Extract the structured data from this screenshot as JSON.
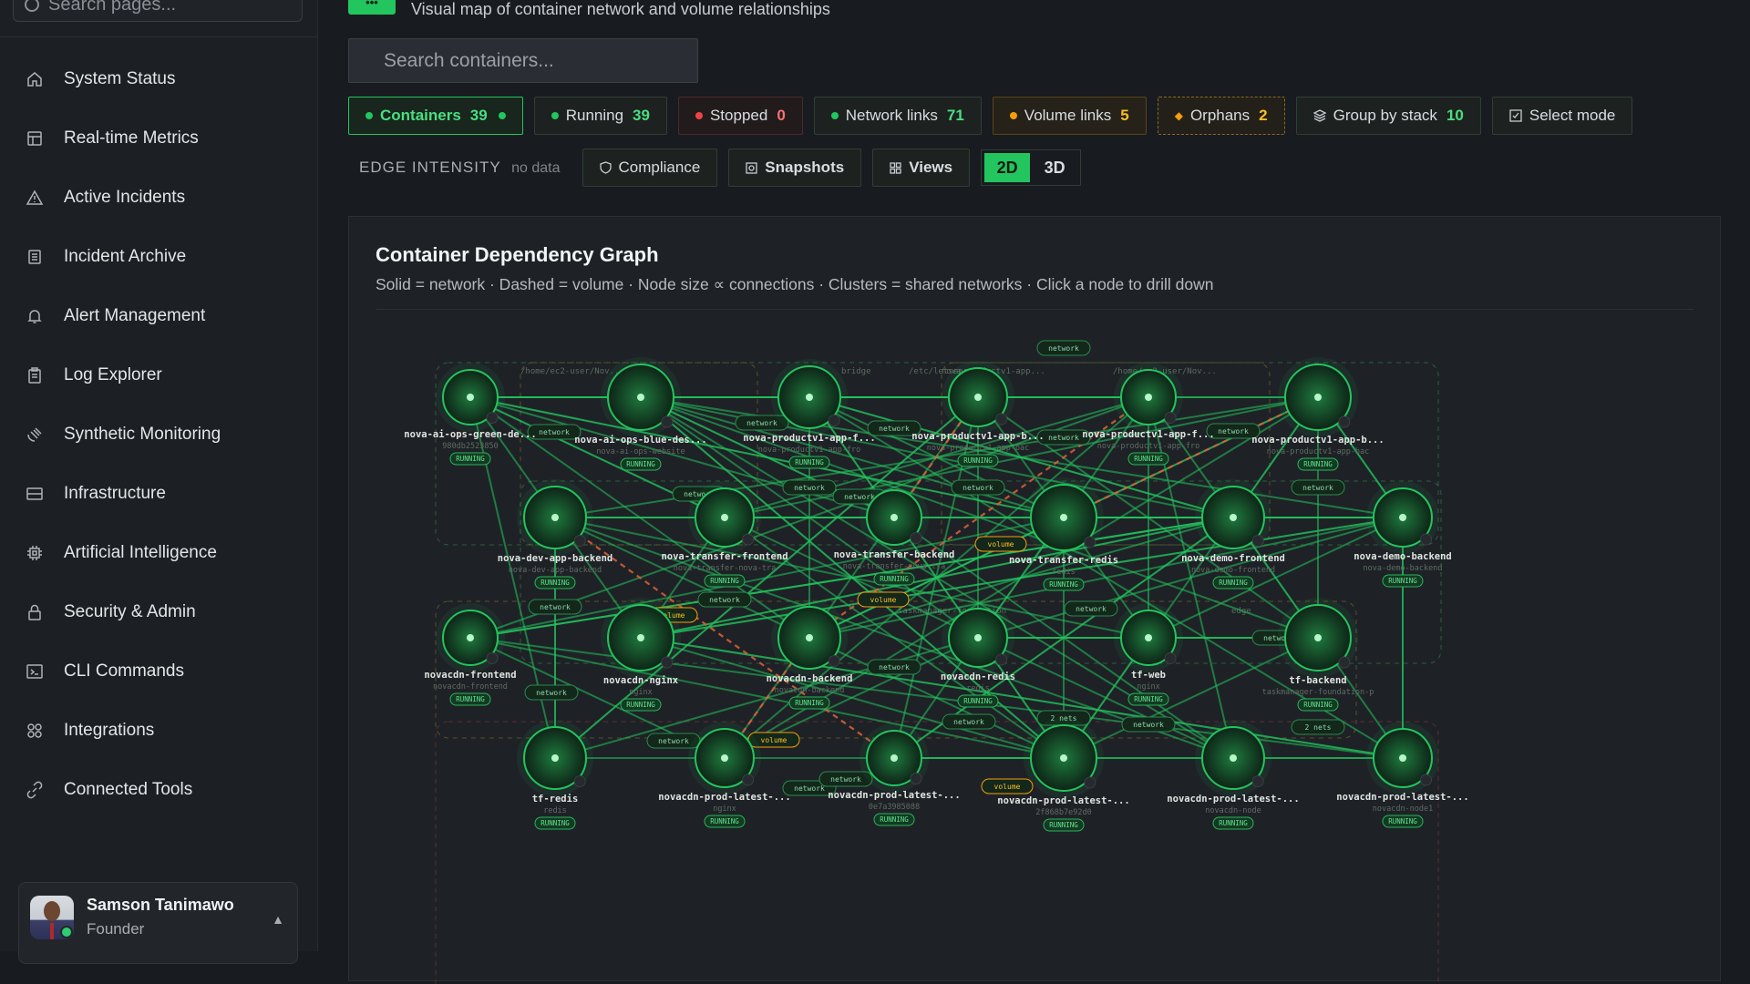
{
  "sidebar": {
    "search_placeholder": "Search pages...",
    "items": [
      {
        "label": "System Status",
        "icon": "home-icon"
      },
      {
        "label": "Real-time Metrics",
        "icon": "metrics-icon"
      },
      {
        "label": "Active Incidents",
        "icon": "warning-icon"
      },
      {
        "label": "Incident Archive",
        "icon": "archive-icon"
      },
      {
        "label": "Alert Management",
        "icon": "bell-icon"
      },
      {
        "label": "Log Explorer",
        "icon": "clipboard-icon"
      },
      {
        "label": "Synthetic Monitoring",
        "icon": "satellite-icon"
      },
      {
        "label": "Infrastructure",
        "icon": "server-icon"
      },
      {
        "label": "Artificial Intelligence",
        "icon": "chip-icon"
      },
      {
        "label": "Security & Admin",
        "icon": "lock-icon"
      },
      {
        "label": "CLI Commands",
        "icon": "terminal-icon"
      },
      {
        "label": "Integrations",
        "icon": "grid-icon"
      },
      {
        "label": "Connected Tools",
        "icon": "link-icon"
      }
    ],
    "user": {
      "name": "Samson Tanimawo",
      "role": "Founder",
      "caret": "▲"
    }
  },
  "header": {
    "subtitle": "Visual map of container network and volume relationships",
    "logo_glyph": "•••"
  },
  "search": {
    "placeholder": "Search containers..."
  },
  "filters": {
    "containers": {
      "label": "Containers",
      "count": "39"
    },
    "running": {
      "label": "Running",
      "count": "39"
    },
    "stopped": {
      "label": "Stopped",
      "count": "0"
    },
    "network_links": {
      "label": "Network links",
      "count": "71"
    },
    "volume_links": {
      "label": "Volume links",
      "count": "5"
    },
    "orphans": {
      "label": "Orphans",
      "count": "2"
    },
    "group_by_stack": {
      "label": "Group by stack",
      "count": "10"
    },
    "select_mode": {
      "label": "Select mode"
    }
  },
  "toolbar": {
    "edge_intensity_label": "EDGE INTENSITY",
    "edge_intensity_value": "no data",
    "compliance": "Compliance",
    "snapshots": "Snapshots",
    "views": "Views",
    "view_2d": "2D",
    "view_3d": "3D"
  },
  "panel": {
    "title": "Container Dependency Graph",
    "subtitle": "Solid = network · Dashed = volume · Node size ∝ connections · Clusters = shared networks · Click a node to drill down"
  },
  "colors": {
    "accent": "#22c55e",
    "running": "#22c55e",
    "stopped": "#ef4444",
    "volume": "#f59e0b",
    "volume_edge": "#e0613a"
  },
  "graph": {
    "status_label": "RUNNING",
    "edge_labels": {
      "network": "network",
      "volume": "volume",
      "two_nets": "2 nets"
    },
    "cluster_labels": [
      "/home/ec2-user/Nov...",
      "bridge",
      "/etc/letsencrypt",
      "nova-productv1-app...",
      "/home/ec2-user/Nov...",
      "taskmanager-foundation",
      "edge"
    ],
    "nodes": [
      {
        "name": "nova-ai-ops-green-de...",
        "sub": "980db2523850"
      },
      {
        "name": "nova-ai-ops-blue-des...",
        "sub": "nova-ai-ops-website"
      },
      {
        "name": "nova-productv1-app-f...",
        "sub": "nova-productv1-app-fro"
      },
      {
        "name": "nova-productv1-app-b...",
        "sub": "nova-productv1-app-bac"
      },
      {
        "name": "nova-productv1-app-f...",
        "sub": "nova-productv1-app-fro"
      },
      {
        "name": "nova-productv1-app-b...",
        "sub": "nova-productv1-app-bac"
      },
      {
        "name": "nova-dev-app-backend",
        "sub": "nova-dev-app-backend"
      },
      {
        "name": "nova-transfer-frontend",
        "sub": "nova-transfer-nova-tra"
      },
      {
        "name": "nova-transfer-backend",
        "sub": "nova-transfer-nova-tra"
      },
      {
        "name": "nova-transfer-redis",
        "sub": "redis"
      },
      {
        "name": "nova-demo-frontend",
        "sub": "nova-demo-frontend"
      },
      {
        "name": "nova-demo-backend",
        "sub": "nova-demo-backend"
      },
      {
        "name": "novacdn-frontend",
        "sub": "novacdn-frontend"
      },
      {
        "name": "novacdn-nginx",
        "sub": "nginx"
      },
      {
        "name": "novacdn-backend",
        "sub": "novacdn-backend"
      },
      {
        "name": "novacdn-redis",
        "sub": "redis"
      },
      {
        "name": "tf-web",
        "sub": "nginx"
      },
      {
        "name": "tf-backend",
        "sub": "taskmanager-foundation-p"
      },
      {
        "name": "tf-redis",
        "sub": "redis"
      },
      {
        "name": "novacdn-prod-latest-...",
        "sub": "nginx"
      },
      {
        "name": "novacdn-prod-latest-...",
        "sub": "0e7a3985088"
      },
      {
        "name": "novacdn-prod-latest-...",
        "sub": "2f868b7e92d0"
      },
      {
        "name": "novacdn-prod-latest-...",
        "sub": "novacdn-node"
      },
      {
        "name": "novacdn-prod-latest-...",
        "sub": "novacdn-node1"
      }
    ]
  }
}
